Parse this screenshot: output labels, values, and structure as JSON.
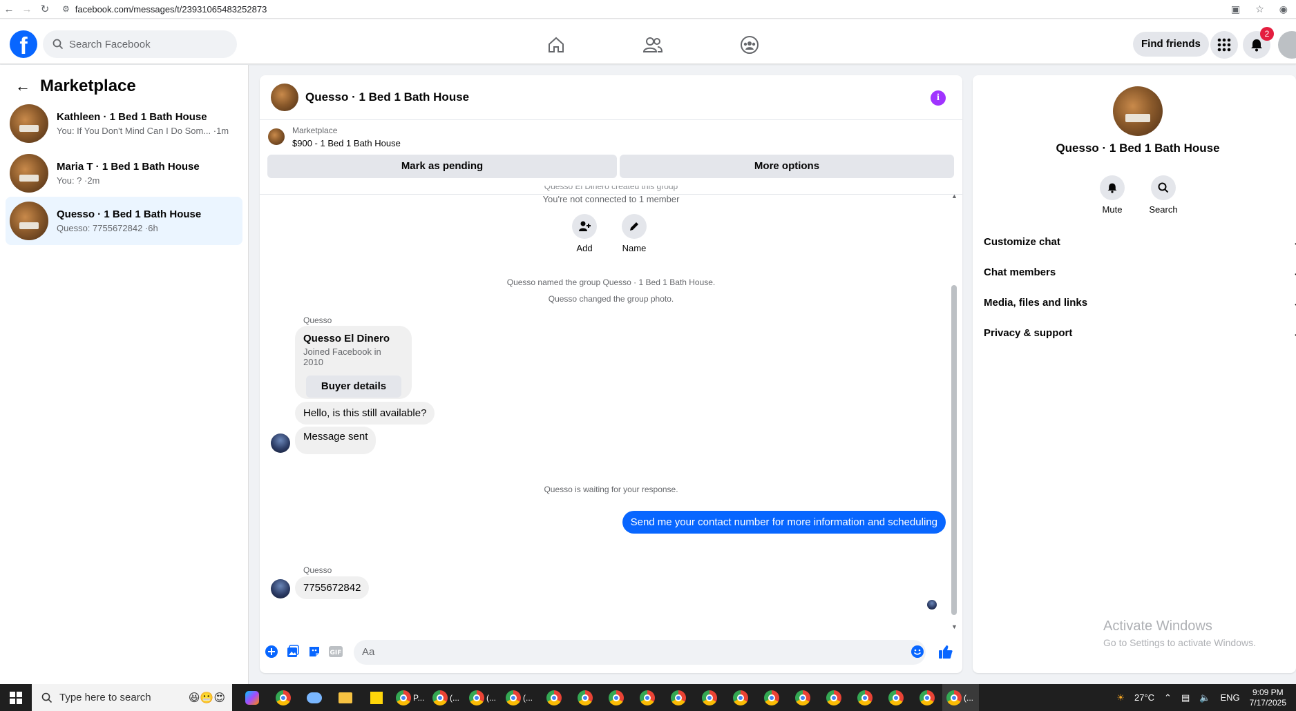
{
  "browser": {
    "url": "facebook.com/messages/t/23931065483252873"
  },
  "topnav": {
    "search_placeholder": "Search Facebook",
    "find_friends_label": "Find friends",
    "notification_count": "2"
  },
  "sidebar": {
    "title": "Marketplace",
    "conversations": [
      {
        "name": "Kathleen · 1 Bed 1 Bath House",
        "preview": "You: If You Don't Mind Can I Do Som... ·1m"
      },
      {
        "name": "Maria T · 1 Bed 1 Bath House",
        "preview": "You: ? ·2m"
      },
      {
        "name": "Quesso · 1 Bed 1 Bath House",
        "preview": "Quesso: 7755672842 ·6h"
      }
    ]
  },
  "chat": {
    "title": "Quesso · 1 Bed 1 Bath House",
    "marketplace_label": "Marketplace",
    "listing": "$900 - 1 Bed 1 Bath House",
    "mark_pending_label": "Mark as pending",
    "more_options_label": "More options",
    "partial_top_text": "Quesso El Dinero created this group",
    "not_connected_text": "You're not connected to 1 member",
    "add_label": "Add",
    "name_label": "Name",
    "sys_named": "Quesso named the group Quesso · 1 Bed 1 Bath House.",
    "sys_photo": "Quesso changed the group photo.",
    "sender_1": "Quesso",
    "card_name": "Quesso El Dinero",
    "card_sub": "Joined Facebook in 2010",
    "buyer_details_label": "Buyer details",
    "msg_available": "Hello, is this still available?",
    "msg_sent": "Message sent",
    "sys_waiting": "Quesso is waiting for your response.",
    "msg_out": "Send me your contact number for more information and scheduling",
    "sender_2": "Quesso",
    "msg_number": "7755672842",
    "composer_placeholder": "Aa"
  },
  "details": {
    "name": "Quesso · 1 Bed 1 Bath House",
    "mute_label": "Mute",
    "search_label": "Search",
    "sections": [
      "Customize chat",
      "Chat members",
      "Media, files and links",
      "Privacy & support"
    ]
  },
  "watermark": {
    "line1": "Activate Windows",
    "line2": "Go to Settings to activate Windows."
  },
  "taskbar": {
    "search_placeholder": "Type here to search",
    "temperature": "27°C",
    "language": "ENG",
    "time": "9:09 PM",
    "date": "7/17/2025",
    "app_labels": [
      "P...",
      "(...",
      "(...",
      "(...",
      "(..."
    ]
  },
  "colors": {
    "brand": "#0866ff",
    "info": "#a033ff",
    "badge": "#e41e3f"
  }
}
